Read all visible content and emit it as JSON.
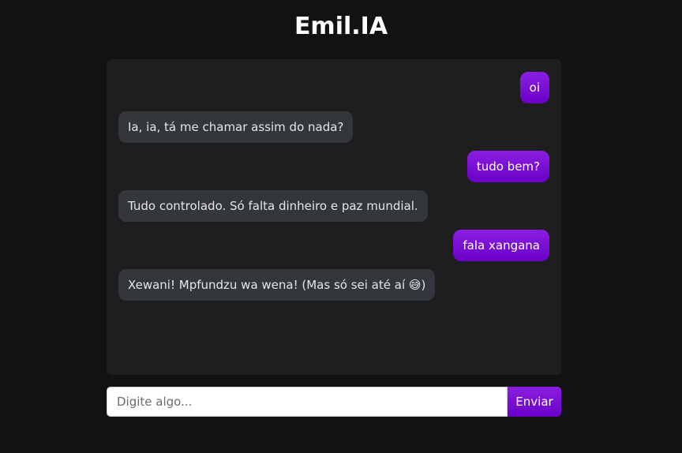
{
  "app": {
    "title": "Emil.IA"
  },
  "messages": [
    {
      "role": "user",
      "text": "oi"
    },
    {
      "role": "bot",
      "text": "Ia, ia, tá me chamar assim do nada?"
    },
    {
      "role": "user",
      "text": "tudo bem?"
    },
    {
      "role": "bot",
      "text": "Tudo controlado. Só falta dinheiro e paz mundial."
    },
    {
      "role": "user",
      "text": "fala xangana"
    },
    {
      "role": "bot",
      "text": "Xewani! Mpfundzu wa wena! (Mas só sei até aí 😅)"
    }
  ],
  "composer": {
    "placeholder": "Digite algo...",
    "value": "",
    "send_label": "Enviar"
  },
  "colors": {
    "accent": "#7a00d6",
    "bot_bubble": "#33363b",
    "panel": "#1e1e1e",
    "background": "#121212"
  }
}
